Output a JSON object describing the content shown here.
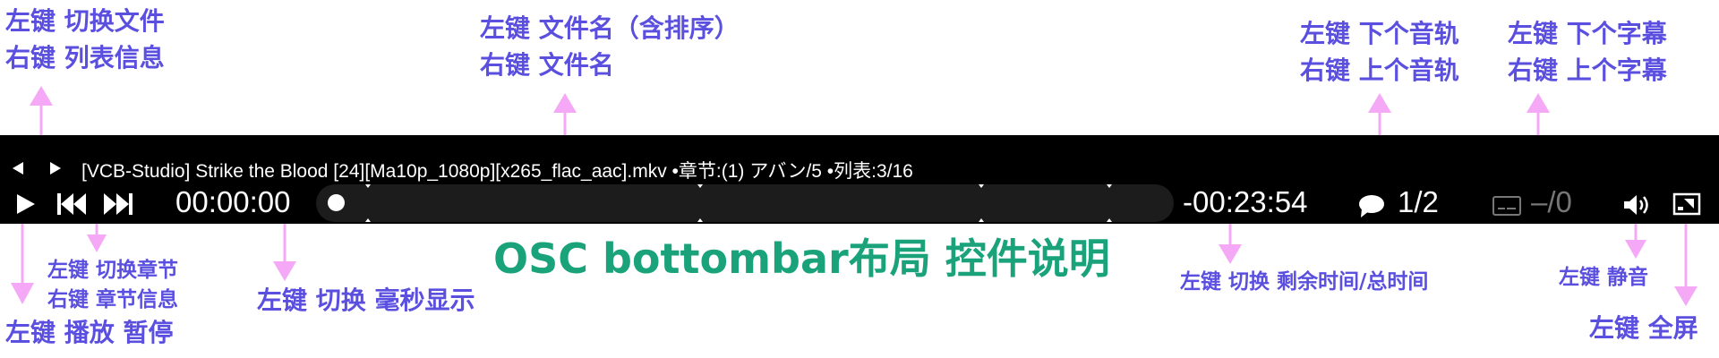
{
  "osc": {
    "title": "[VCB-Studio] Strike the Blood [24][Ma10p_1080p][x265_flac_aac].mkv •章节:(1) アバン/5 •列表:3/16",
    "time_current": "00:00:00",
    "time_remaining": "-00:23:54",
    "audio_track": "1/2",
    "subtitle_track": "–/0"
  },
  "notes": {
    "playlist": [
      "左键 切换文件",
      "右键 列表信息"
    ],
    "filename": [
      "左键 文件名（含排序）",
      "右键 文件名"
    ],
    "audio": [
      "左键 下个音轨",
      "右键 上个音轨"
    ],
    "subtitle": [
      "左键 下个字幕",
      "右键 上个字幕"
    ],
    "chapter": [
      "左键 切换章节",
      "右键 章节信息"
    ],
    "play": [
      "左键 播放 暂停"
    ],
    "ms": [
      "左键 切换 毫秒显示"
    ],
    "remaining": [
      "左键 切换 剩余时间/总时间"
    ],
    "mute": [
      "左键 静音"
    ],
    "fullscreen": [
      "左键 全屏"
    ]
  },
  "caption": "OSC bottombar布局 控件说明",
  "colors": {
    "annotation": "#5b4fe0",
    "arrow": "#f5a8f5",
    "caption": "#1aa37a",
    "bar": "#000000",
    "seek_track": "#1c1c1c",
    "disabled": "#777777"
  },
  "icons": {
    "prev_file": "triangle-left-icon",
    "next_file": "triangle-right-icon",
    "play": "play-icon",
    "prev_chapter": "skip-back-icon",
    "next_chapter": "skip-forward-icon",
    "audio": "speech-bubble-icon",
    "subtitle": "subtitle-box-icon",
    "volume": "volume-icon",
    "fullscreen": "fullscreen-icon"
  }
}
